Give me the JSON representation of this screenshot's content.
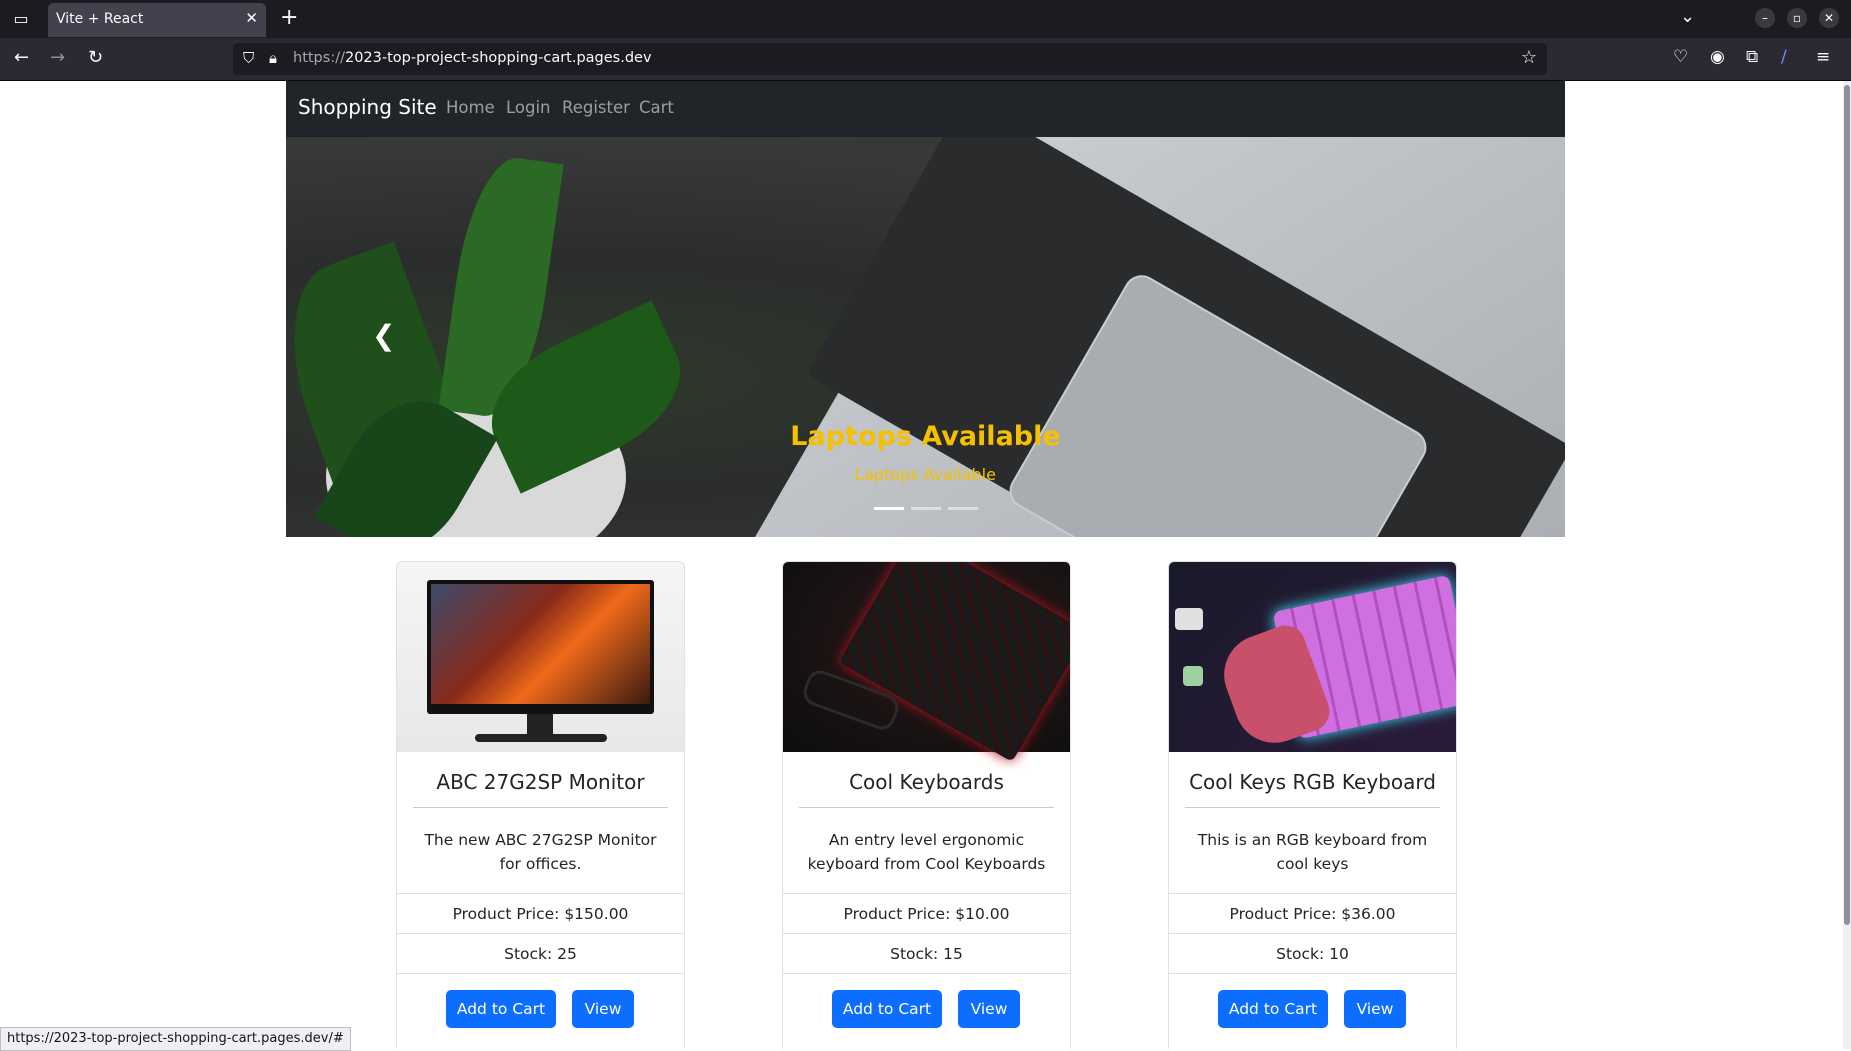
{
  "browser": {
    "tab_title": "Vite + React",
    "url_scheme": "https://",
    "url_host": "2023-top-project-shopping-cart.pages.dev",
    "status_url": "https://2023-top-project-shopping-cart.pages.dev/#"
  },
  "site": {
    "brand": "Shopping Site",
    "nav": [
      "Home",
      "Login",
      "Register",
      "Cart"
    ]
  },
  "carousel": {
    "title": "Laptops Available",
    "subtitle": "Laptops Available",
    "slides": 3,
    "active": 0
  },
  "products": [
    {
      "name": "ABC 27G2SP Monitor",
      "desc": "The new ABC 27G2SP Monitor for offices.",
      "price": "Product Price: $150.00",
      "stock": "Stock: 25",
      "add": "Add to Cart",
      "view": "View"
    },
    {
      "name": "Cool Keyboards",
      "desc": "An entry level ergonomic keyboard from Cool Keyboards",
      "price": "Product Price: $10.00",
      "stock": "Stock: 15",
      "add": "Add to Cart",
      "view": "View"
    },
    {
      "name": "Cool Keys RGB Keyboard",
      "desc": "This is an RGB keyboard from cool keys",
      "price": "Product Price: $36.00",
      "stock": "Stock: 10",
      "add": "Add to Cart",
      "view": "View"
    }
  ],
  "colors": {
    "primary": "#0d6efd",
    "navbar": "#212529",
    "caption": "#f5c000"
  }
}
